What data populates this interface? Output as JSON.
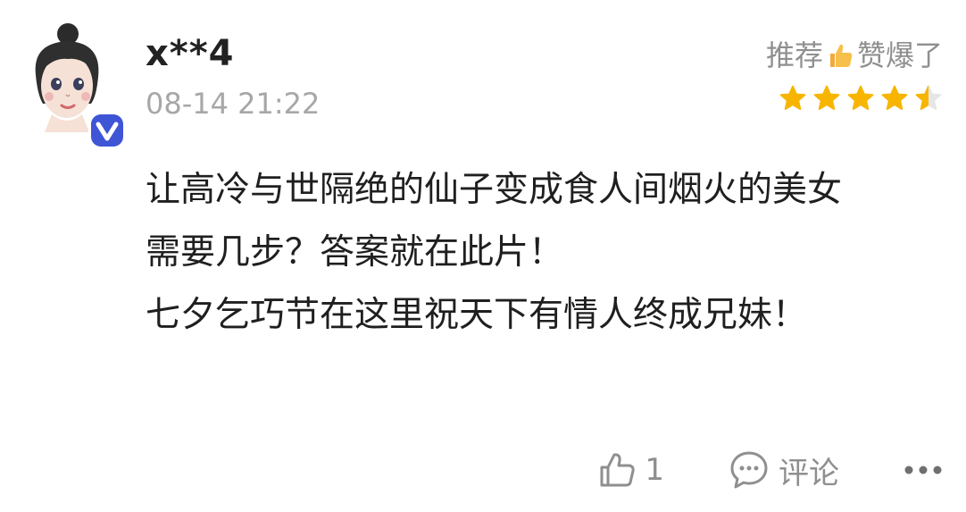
{
  "review": {
    "username": "x**4",
    "timestamp": "08-14 21:22",
    "recommend": {
      "prefix": "推荐",
      "icon": "thumbs-up-emoji",
      "suffix": "赞爆了"
    },
    "rating": 4.5,
    "content_lines": [
      "让高冷与世隔绝的仙子变成食人间烟火的美女",
      "需要几步？答案就在此片！",
      "七夕乞巧节在这里祝天下有情人终成兄妹！"
    ],
    "actions": {
      "like_count": "1",
      "comment_label": "评论"
    }
  },
  "colors": {
    "star": "#f7b500",
    "star_empty": "#e6e6e6",
    "muted_text": "#8f8f8f",
    "badge": "#3f55d6"
  },
  "icons": {
    "avatar": "cartoon-girl-avatar",
    "badge": "verified-v-badge",
    "like": "thumbs-up-outline-icon",
    "comment": "chat-bubble-icon",
    "more": "more-dots-icon"
  }
}
